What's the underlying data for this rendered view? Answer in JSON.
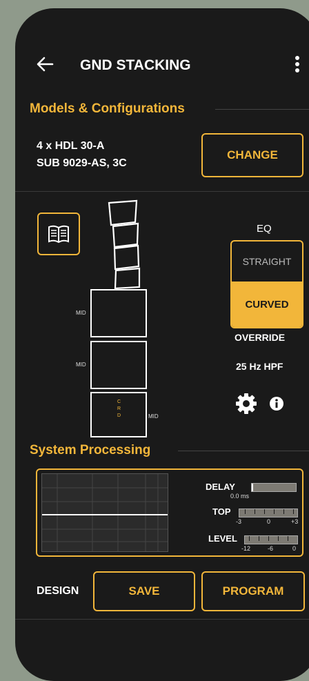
{
  "header": {
    "title": "GND STACKING",
    "back_icon": "arrow-left-icon",
    "menu_icon": "kebab-menu-icon"
  },
  "models": {
    "section_title": "Models & Configurations",
    "line1": "4 x HDL 30-A",
    "line2": "SUB 9029-AS, 3C",
    "change_label": "CHANGE"
  },
  "stack": {
    "book_icon": "manual-book-icon",
    "mid_labels": [
      "MID",
      "MID",
      "MID"
    ],
    "crd_label": [
      "C",
      "R",
      "D"
    ]
  },
  "eq": {
    "title": "EQ",
    "options": [
      "STRAIGHT",
      "CURVED"
    ],
    "selected": "CURVED",
    "override_label": "OVERRIDE",
    "hpf_label": "25 Hz HPF",
    "settings_icon": "gear-icon",
    "info_icon": "info-icon"
  },
  "processing": {
    "section_title": "System Processing",
    "delay_label": "DELAY",
    "delay_value": "0.0 ms",
    "top_label": "TOP",
    "top_scale": [
      "-3",
      "0",
      "+3"
    ],
    "level_label": "LEVEL",
    "level_scale": [
      "-12",
      "-6",
      "0"
    ]
  },
  "footer": {
    "design_label": "DESIGN",
    "save_label": "SAVE",
    "program_label": "PROGRAM"
  },
  "colors": {
    "accent": "#f2b63a",
    "background": "#1a1a1a",
    "outer": "#8f9a8b"
  }
}
